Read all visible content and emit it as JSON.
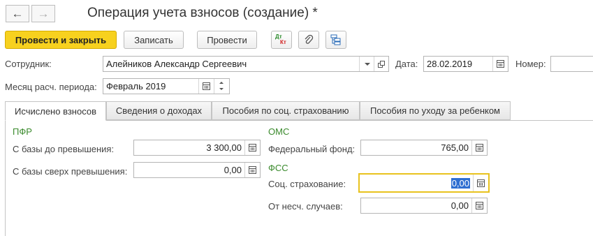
{
  "window": {
    "title": "Операция учета взносов (создание) *"
  },
  "toolbar": {
    "post_and_close": "Провести и закрыть",
    "save": "Записать",
    "post": "Провести",
    "dt_kt_top": "Дт",
    "dt_kt_bottom": "Кт"
  },
  "header": {
    "employee_label": "Сотрудник:",
    "employee_value": "Алейников Александр Сергеевич",
    "date_label": "Дата:",
    "date_value": "28.02.2019",
    "number_label": "Номер:",
    "number_value": "",
    "period_label": "Месяц расч. периода:",
    "period_value": "Февраль 2019"
  },
  "tabs": [
    {
      "label": "Исчислено взносов",
      "active": true
    },
    {
      "label": "Сведения о доходах",
      "active": false
    },
    {
      "label": "Пособия по соц. страхованию",
      "active": false
    },
    {
      "label": "Пособия по уходу за ребенком",
      "active": false
    }
  ],
  "pfr": {
    "title": "ПФР",
    "base_below_label": "С базы до превышения:",
    "base_below_value": "3 300,00",
    "base_above_label": "С базы сверх превышения:",
    "base_above_value": "0,00"
  },
  "oms": {
    "title": "ОМС",
    "federal_label": "Федеральный фонд:",
    "federal_value": "765,00"
  },
  "fss": {
    "title": "ФСС",
    "social_label": "Соц. страхование:",
    "social_value": "0,00",
    "accident_label": "От несч. случаев:",
    "accident_value": "0,00"
  },
  "colors": {
    "primary_button": "#f7d11f",
    "section_title": "#3a8a2c",
    "focus_border": "#e8c21e"
  }
}
